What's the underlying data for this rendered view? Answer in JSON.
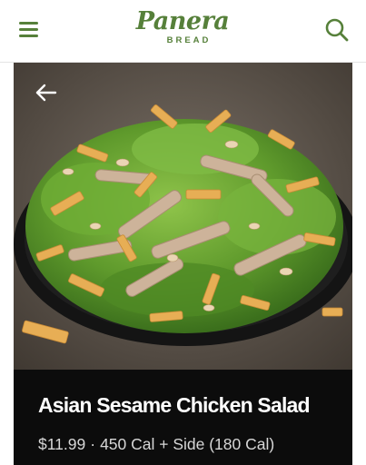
{
  "header": {
    "logo_text": "Panera",
    "logo_subtext": "BREAD",
    "menu_icon": "hamburger-menu-icon",
    "search_icon": "search-icon",
    "brand_color": "#56803a"
  },
  "hero": {
    "image_subject": "Asian Sesame Chicken Salad on a black plate",
    "back_icon": "arrow-left-icon"
  },
  "item": {
    "name": "Asian Sesame Chicken Salad",
    "price": "$11.99",
    "separator": "·",
    "calories": "450 Cal + Side (180 Cal)"
  },
  "colors": {
    "info_panel_background": "#0c0c0c",
    "title_text": "#ffffff",
    "meta_text": "#d7d7d7"
  }
}
